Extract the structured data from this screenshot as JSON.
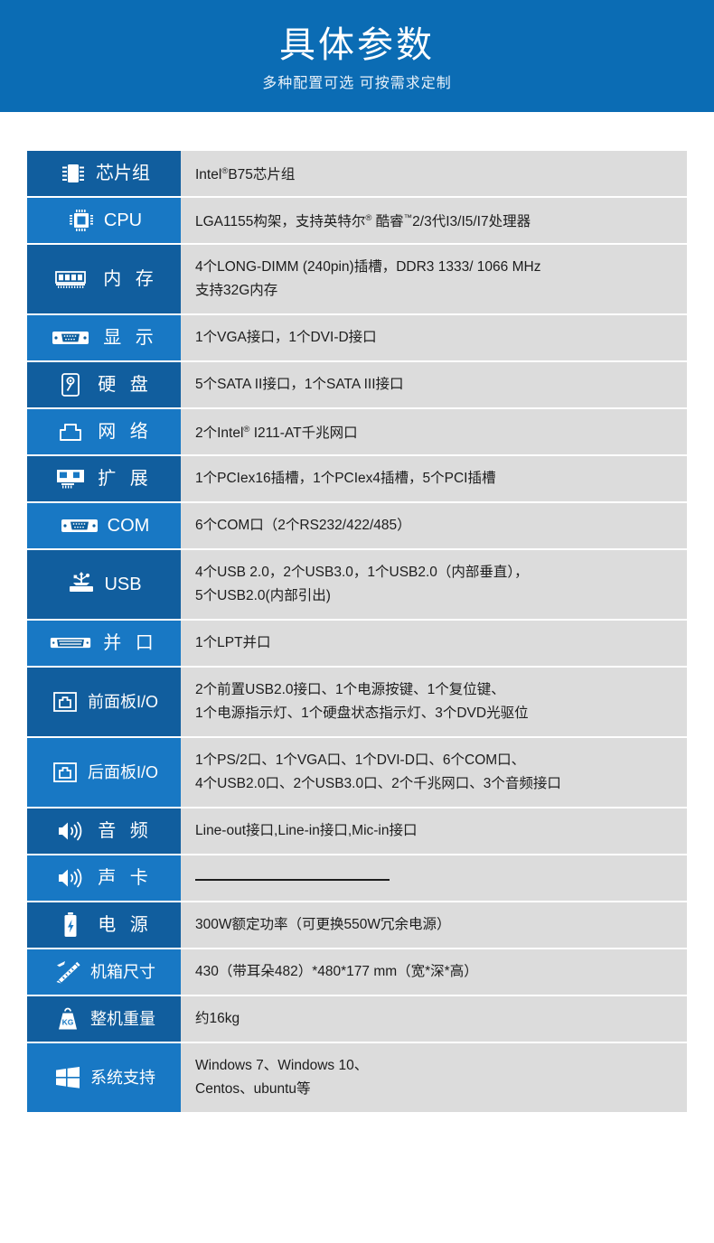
{
  "banner": {
    "title": "具体参数",
    "subtitle": "多种配置可选 可按需求定制",
    "bg_color": "#0b6cb4"
  },
  "theme": {
    "label_blue_dark": "#115e9e",
    "label_blue_light": "#1878c4",
    "value_bg": "#dcdcdc",
    "value_text": "#1d1d1d",
    "label_text": "#ffffff"
  },
  "spec_table": {
    "rows": [
      {
        "icon": "chipset-icon",
        "label": "芯片组",
        "lines": [
          "Intel<sup>®</sup>B75芯片组"
        ]
      },
      {
        "icon": "cpu-icon",
        "label": "CPU",
        "lines": [
          "LGA1155构架，支持英特尔<sup>®</sup> 酷睿<sup>™</sup>2/3代I3/I5/I7处理器"
        ]
      },
      {
        "icon": "memory-icon",
        "label": "内 存",
        "lines": [
          "4个LONG-DIMM (240pin)插槽，DDR3 1333/ 1066 MHz",
          "支持32G内存"
        ]
      },
      {
        "icon": "vga-port-icon",
        "label": "显 示",
        "lines": [
          "1个VGA接口，1个DVI-D接口"
        ]
      },
      {
        "icon": "harddisk-icon",
        "label": "硬 盘",
        "lines": [
          "5个SATA II接口，1个SATA III接口"
        ]
      },
      {
        "icon": "network-port-icon",
        "label": "网 络",
        "lines": [
          "2个Intel<sup>®</sup> I211-AT千兆网口"
        ]
      },
      {
        "icon": "expansion-card-icon",
        "label": "扩 展",
        "lines": [
          "1个PCIex16插槽，1个PCIex4插槽，5个PCI插槽"
        ]
      },
      {
        "icon": "serial-port-icon",
        "label": "COM",
        "lines": [
          "6个COM口（2个RS232/422/485）"
        ]
      },
      {
        "icon": "usb-icon",
        "label": "USB",
        "lines": [
          "4个USB 2.0，2个USB3.0，1个USB2.0（内部垂直），",
          "5个USB2.0(内部引出)"
        ]
      },
      {
        "icon": "parallel-port-icon",
        "label": "并 口",
        "lines": [
          "1个LPT并口"
        ]
      },
      {
        "icon": "front-panel-icon",
        "label": "前面板I/O",
        "lines": [
          "2个前置USB2.0接口、1个电源按键、1个复位键、",
          "1个电源指示灯、1个硬盘状态指示灯、3个DVD光驱位"
        ]
      },
      {
        "icon": "rear-panel-icon",
        "label": "后面板I/O",
        "lines": [
          "1个PS/2口、1个VGA口、1个DVI-D口、6个COM口、",
          "4个USB2.0口、2个USB3.0口、2个千兆网口、3个音频接口"
        ]
      },
      {
        "icon": "audio-icon",
        "label": "音 频",
        "lines": [
          "Line-out接口,Line-in接口,Mic-in接口"
        ]
      },
      {
        "icon": "soundcard-icon",
        "label": "声 卡",
        "lines": [
          "—"
        ]
      },
      {
        "icon": "power-icon",
        "label": "电 源",
        "lines": [
          "300W额定功率（可更换550W冗余电源）"
        ]
      },
      {
        "icon": "dimensions-icon",
        "label": "机箱尺寸",
        "lines": [
          "430（带耳朵482）*480*177 mm（宽*深*高）"
        ]
      },
      {
        "icon": "weight-icon",
        "label": "整机重量",
        "lines": [
          "约16kg"
        ]
      },
      {
        "icon": "windows-icon",
        "label": "系统支持",
        "lines": [
          "Windows 7、Windows 10、",
          "Centos、ubuntu等"
        ]
      }
    ]
  }
}
